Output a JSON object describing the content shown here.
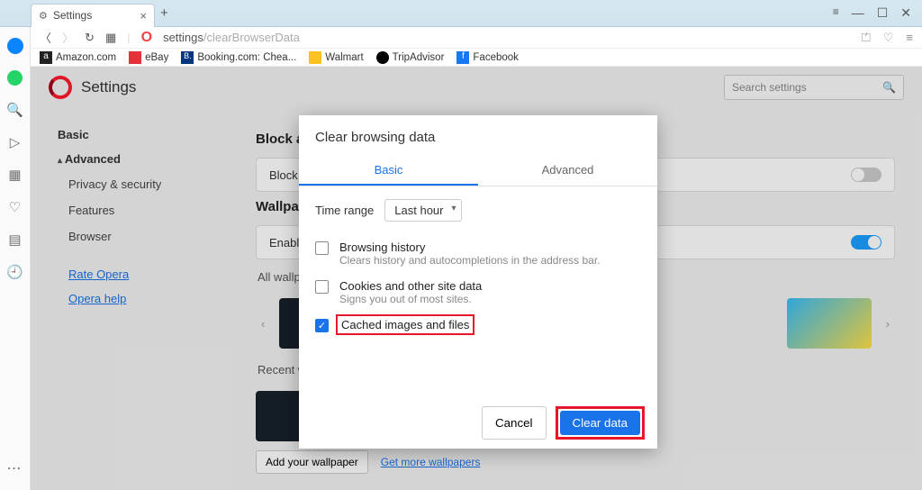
{
  "window": {
    "tab_title": "Settings"
  },
  "addressbar": {
    "url_prefix": "settings",
    "url_path": "/clearBrowserData"
  },
  "bookmarks": [
    {
      "label": "Amazon.com"
    },
    {
      "label": "eBay"
    },
    {
      "label": "Booking.com: Chea..."
    },
    {
      "label": "Walmart"
    },
    {
      "label": "TripAdvisor"
    },
    {
      "label": "Facebook"
    }
  ],
  "settings": {
    "title": "Settings",
    "search_placeholder": "Search settings",
    "nav": {
      "basic": "Basic",
      "advanced": "Advanced",
      "items": [
        "Privacy & security",
        "Features",
        "Browser"
      ],
      "rate": "Rate Opera",
      "help": "Opera help"
    },
    "blockads": {
      "heading": "Block ads",
      "row": "Block ads"
    },
    "wallpapers": {
      "heading": "Wallpapers",
      "enable": "Enable wallpapers",
      "all": "All wallpapers",
      "recent": "Recent wallpapers",
      "add": "Add your wallpaper",
      "more": "Get more wallpapers"
    }
  },
  "modal": {
    "title": "Clear browsing data",
    "tabs": {
      "basic": "Basic",
      "advanced": "Advanced"
    },
    "time_label": "Time range",
    "time_value": "Last hour",
    "opts": [
      {
        "title": "Browsing history",
        "desc": "Clears history and autocompletions in the address bar.",
        "checked": false
      },
      {
        "title": "Cookies and other site data",
        "desc": "Signs you out of most sites.",
        "checked": false
      },
      {
        "title": "Cached images and files",
        "desc": "",
        "checked": true,
        "highlight": true
      }
    ],
    "cancel": "Cancel",
    "clear": "Clear data"
  }
}
